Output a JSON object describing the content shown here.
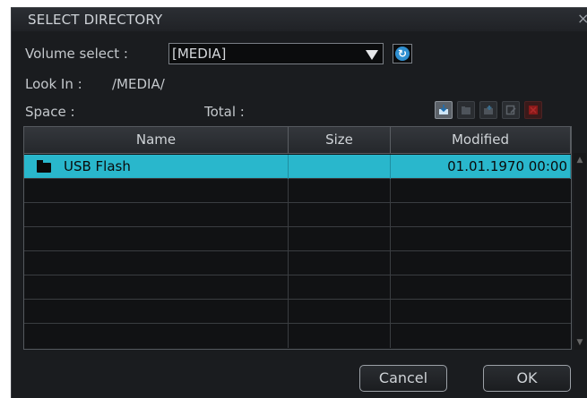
{
  "dialog": {
    "title": "SELECT DIRECTORY",
    "close_glyph": "×"
  },
  "volume": {
    "label": "Volume select :",
    "selected": "[MEDIA]",
    "refresh_icon": "refresh-icon"
  },
  "look_in": {
    "label": "Look In :",
    "path": "/MEDIA/"
  },
  "space": {
    "space_label": "Space :",
    "total_label": "Total :"
  },
  "toolbar": {
    "icons": [
      "save-to-icon",
      "folder-icon",
      "new-folder-icon",
      "rename-icon",
      "delete-icon"
    ]
  },
  "table": {
    "columns": [
      "Name",
      "Size",
      "Modified"
    ],
    "rows": [
      {
        "name": "USB Flash",
        "size": "",
        "modified": "01.01.1970 00:00",
        "selected": true
      }
    ]
  },
  "buttons": {
    "cancel": "Cancel",
    "ok": "OK"
  },
  "colors": {
    "selection": "#29b7cc",
    "background": "#1a1c1f",
    "refresh": "#2f8fd0",
    "delete": "#8a1a1a"
  }
}
